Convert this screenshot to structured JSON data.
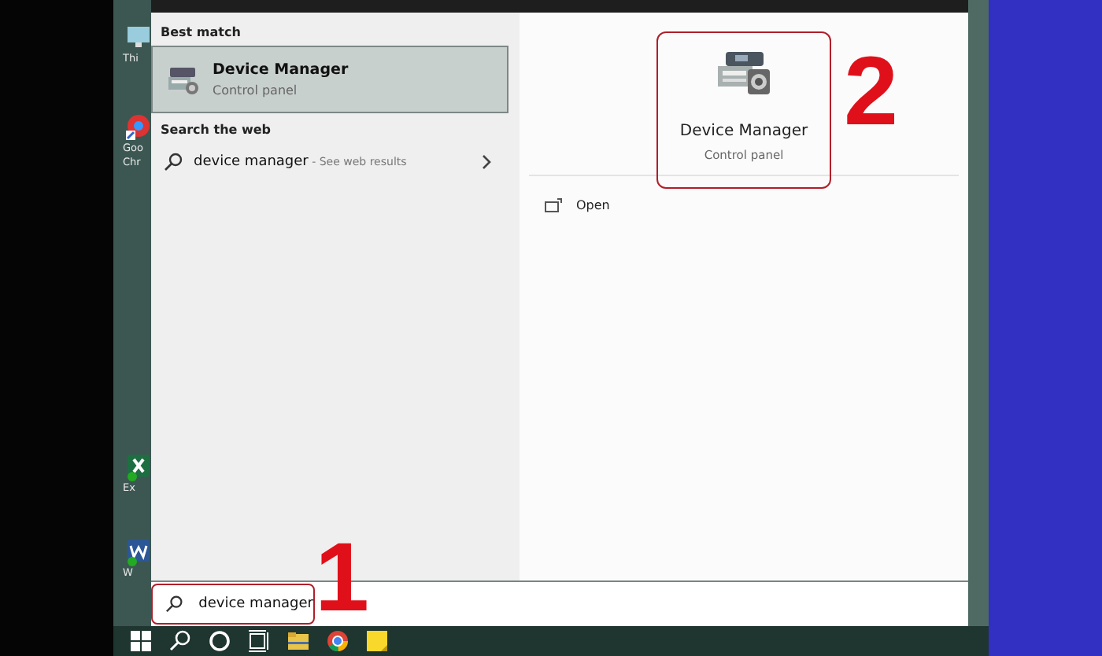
{
  "desktop_icons": [
    {
      "label": "Thi",
      "kind": "pc"
    },
    {
      "label": "Goo\nChr",
      "kind": "chrome"
    },
    {
      "label": "Ex",
      "kind": "excel"
    },
    {
      "label": "W",
      "kind": "word"
    }
  ],
  "search_results": {
    "best_match_heading": "Best match",
    "best_match": {
      "title": "Device Manager",
      "subtitle": "Control panel",
      "selected": true
    },
    "web_heading": "Search the web",
    "web_result": {
      "query": "device manager",
      "hint": " - See web results"
    }
  },
  "preview": {
    "title": "Device Manager",
    "subtitle": "Control panel",
    "highlighted": true,
    "annotation": "2",
    "actions": [
      {
        "label": "Open"
      }
    ]
  },
  "search_box": {
    "value": "device manager",
    "highlighted": true,
    "annotation": "1"
  },
  "taskbar": {
    "icons": [
      {
        "kind": "start"
      },
      {
        "kind": "search"
      },
      {
        "kind": "cortana"
      },
      {
        "kind": "taskview"
      },
      {
        "kind": "folder"
      },
      {
        "kind": "chrome"
      },
      {
        "kind": "notes"
      }
    ]
  }
}
